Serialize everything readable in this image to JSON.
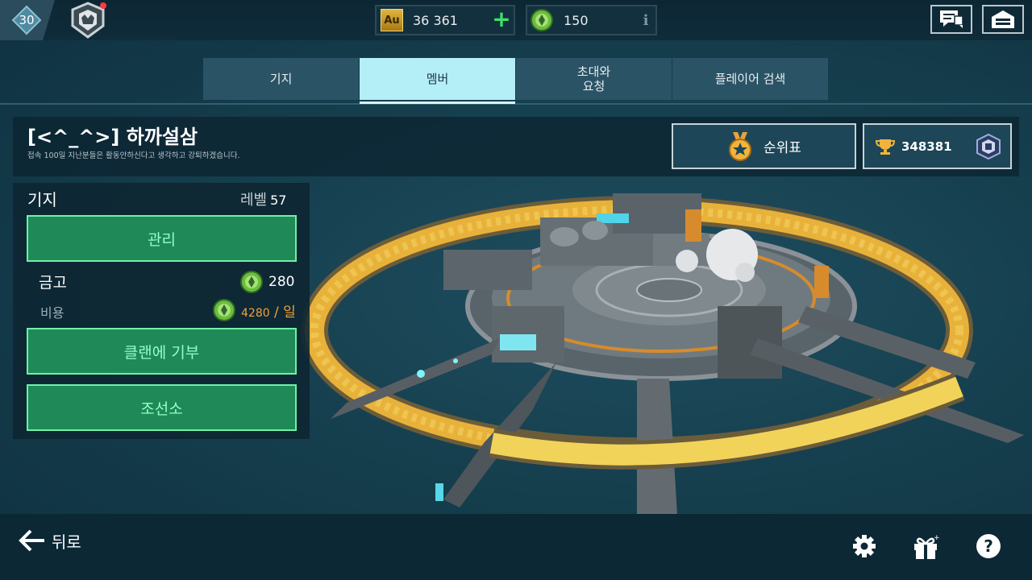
{
  "topbar": {
    "player_level": "30",
    "gold_label": "Au",
    "gold_value": "36 361",
    "token_value": "150",
    "info_label": "i"
  },
  "tabs": [
    {
      "label": "기지"
    },
    {
      "label": "멤버"
    },
    {
      "label": "초대와\n요청"
    },
    {
      "label": "플레이어 검색"
    }
  ],
  "active_tab": 1,
  "clan": {
    "name": "[<^_^>] 하까설삼",
    "description": "접속 100일 지난분들은 활동안하신다고 생각하고 강퇴하겠습니다.",
    "rank_button_label": "순위표",
    "trophies": "348381"
  },
  "base_panel": {
    "title": "기지",
    "level_label": "레벨",
    "level_value": "57",
    "manage_label": "관리",
    "vault_label": "금고",
    "vault_value": "280",
    "cost_label": "비용",
    "cost_value": "4280",
    "cost_unit": " / 일",
    "donate_label": "클랜에 기부",
    "shipyard_label": "조선소"
  },
  "bottombar": {
    "back_label": "뒤로"
  },
  "icons": {
    "level": "diamond-icon",
    "rank_emblem": "rank-emblem-icon",
    "plus": "plus-icon",
    "chat": "chat-icon",
    "base": "hangar-icon",
    "medal": "medal-icon",
    "trophy": "trophy-icon",
    "league": "league-badge-icon",
    "token": "clan-token-icon",
    "back": "arrow-left-icon",
    "settings": "gear-icon",
    "gift": "gift-icon",
    "help": "help-icon"
  },
  "colors": {
    "accent_green": "#1f8a58",
    "accent_green_border": "#71f0a6",
    "tab_active": "#b4eef7",
    "tab_inactive": "#2b5366",
    "cost_orange": "#f2a23a",
    "plus_green": "#3fe16a"
  }
}
